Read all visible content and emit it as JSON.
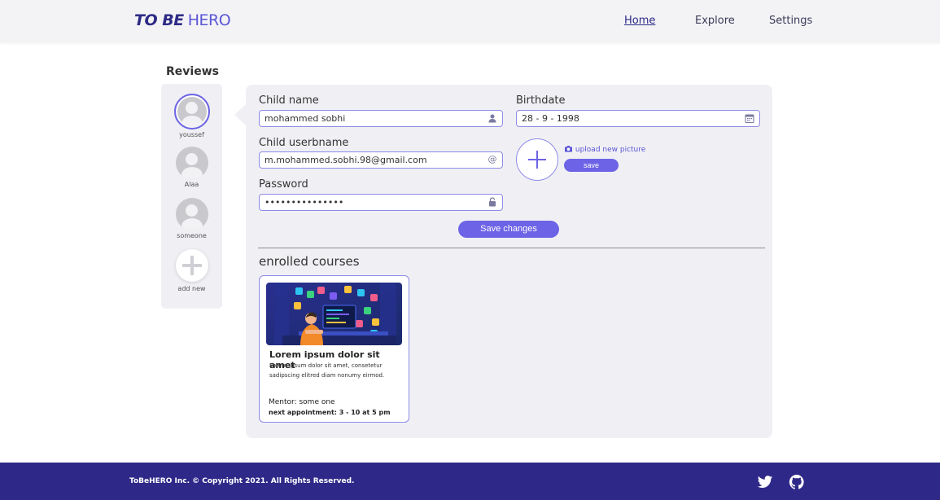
{
  "header": {
    "logo_bold": "TO BE",
    "logo_light": "HERO",
    "nav": [
      {
        "label": "Home",
        "active": true
      },
      {
        "label": "Explore",
        "active": false
      },
      {
        "label": "Settings",
        "active": false
      }
    ]
  },
  "sidebar": {
    "title": "Reviews",
    "children": [
      {
        "name": "youssef",
        "active": true
      },
      {
        "name": "Alaa",
        "active": false
      },
      {
        "name": "someone",
        "active": false
      }
    ],
    "add_label": "add new"
  },
  "form": {
    "child_name_label": "Child name",
    "child_name_value": "mohammed sobhi",
    "username_label": "Child userbname",
    "username_value": "m.mohammed.sobhi.98@gmail.com",
    "password_label": "Password",
    "password_value": "•••••••••••••••",
    "birthdate_label": "Birthdate",
    "birthdate_value": "28 - 9 - 1998",
    "upload_label": "upload new picture",
    "save_label": "save",
    "save_changes_label": "Save changes"
  },
  "courses": {
    "title": "enrolled courses",
    "items": [
      {
        "title": "Lorem ipsum dolor sit amet",
        "description": "Lorem ipsum dolor sit amet, consetetur sadipscing elitred diam nonumy eirmod.",
        "mentor": "Mentor: some one",
        "appointment": "next appointment: 3 - 10   at 5 pm"
      }
    ]
  },
  "footer": {
    "copyright": "ToBeHERO  Inc. © Copyright 2021. All Rights Reserved."
  },
  "colors": {
    "accent": "#6c63e6",
    "brand_dark": "#2e2988",
    "panel_bg": "#f0f0f4"
  },
  "icons": [
    "user-icon",
    "at-icon",
    "lock-icon",
    "calendar-icon",
    "camera-icon",
    "plus-icon",
    "twitter-icon",
    "github-icon"
  ]
}
